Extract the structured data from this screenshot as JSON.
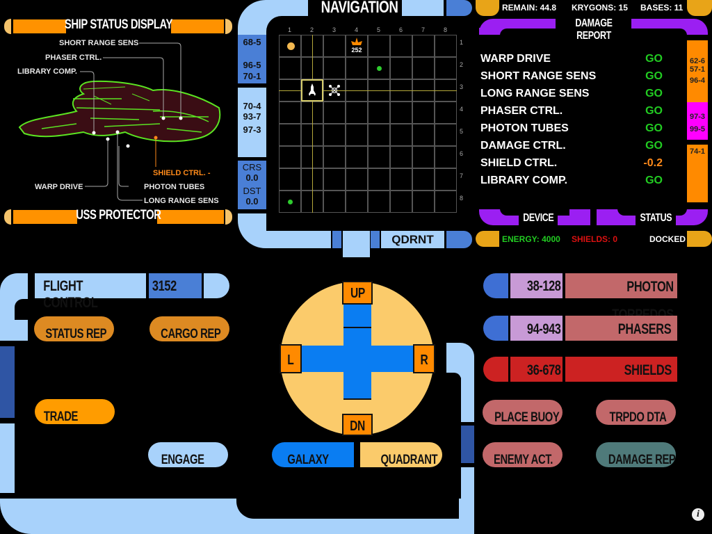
{
  "ship_status": {
    "title": "SHIP STATUS DISPLAY",
    "ship_name": "USS PROTECTOR",
    "labels": {
      "short_range": "SHORT RANGE SENS",
      "phaser": "PHASER CTRL.",
      "library": "LIBRARY COMP.",
      "shield": "SHIELD CTRL. -",
      "warp": "WARP DRIVE",
      "photon": "PHOTON TUBES",
      "long_range": "LONG RANGE SENS"
    }
  },
  "navigation": {
    "title": "NAVIGATION",
    "side_codes": [
      "68-5",
      "96-5",
      "70-1",
      "70-4",
      "93-7",
      "97-3"
    ],
    "crs_label": "CRS",
    "crs_value": "0.0",
    "dst_label": "DST",
    "dst_value": "0.0",
    "qdrnt_label": "QDRNT",
    "col_numbers": [
      "1",
      "2",
      "3",
      "4",
      "5",
      "6",
      "7",
      "8"
    ],
    "row_numbers": [
      "1",
      "2",
      "3",
      "4",
      "5",
      "6",
      "7",
      "8"
    ],
    "objects": [
      {
        "type": "star",
        "col": 1,
        "row": 1,
        "color": "#f2b850"
      },
      {
        "type": "enemy",
        "col": 4,
        "row": 1,
        "label": "252",
        "color": "#ff8a00"
      },
      {
        "type": "planet",
        "col": 5,
        "row": 2,
        "color": "#2ecc2e"
      },
      {
        "type": "player-ship",
        "col": 2,
        "row": 3
      },
      {
        "type": "starbase",
        "col": 3,
        "row": 3
      },
      {
        "type": "planet",
        "col": 1,
        "row": 8,
        "color": "#2ecc2e"
      }
    ]
  },
  "header_stats": {
    "remain": "REMAIN: 44.8",
    "krygons": "KRYGONS: 15",
    "bases": "BASES: 11"
  },
  "damage_report": {
    "title": "DAMAGE REPORT",
    "col_device": "DEVICE",
    "col_status": "STATUS",
    "rows": [
      {
        "device": "WARP DRIVE",
        "status": "GO",
        "color": "#22cc22"
      },
      {
        "device": "SHORT RANGE SENS",
        "status": "GO",
        "color": "#22cc22"
      },
      {
        "device": "LONG RANGE SENS",
        "status": "GO",
        "color": "#22cc22"
      },
      {
        "device": "PHASER CTRL.",
        "status": "GO",
        "color": "#22cc22"
      },
      {
        "device": "PHOTON TUBES",
        "status": "GO",
        "color": "#22cc22"
      },
      {
        "device": "DAMAGE CTRL.",
        "status": "GO",
        "color": "#22cc22"
      },
      {
        "device": "SHIELD CTRL.",
        "status": "-0.2",
        "color": "#ff8a1a"
      },
      {
        "device": "LIBRARY COMP.",
        "status": "GO",
        "color": "#22cc22"
      }
    ],
    "side_codes_orange_a": [
      "62-6",
      "57-1",
      "96-4"
    ],
    "side_codes_magenta": [
      "97-3",
      "99-5"
    ],
    "side_codes_orange_b": [
      "74-1"
    ]
  },
  "footer_stats": {
    "energy": "ENERGY: 4000",
    "shields": "SHIELDS: 0",
    "docked": "DOCKED",
    "energy_color": "#22cc22",
    "shields_color": "#dd1111"
  },
  "flight_control": {
    "title": "FLIGHT CONTROL",
    "code": "3152",
    "buttons": {
      "status_rep": "STATUS REP",
      "cargo_rep": "CARGO REP",
      "trade": "TRADE",
      "engage": "ENGAGE"
    }
  },
  "direction_pad": {
    "up": "UP",
    "down": "DN",
    "left": "L",
    "right": "R",
    "galaxy": "GALAXY",
    "quadrant": "QUADRANT"
  },
  "weapons": {
    "photon_code": "38-128",
    "photon_label": "PHOTON TORPEDOS",
    "phaser_code": "94-943",
    "phaser_label": "PHASERS",
    "shield_code": "36-678",
    "shield_label": "SHIELDS",
    "buttons": {
      "place_buoy": "PLACE BUOY",
      "trpdo_dta": "TRPDO DTA",
      "enemy_act": "ENEMY ACT.",
      "damage_rep": "DAMAGE REP."
    }
  },
  "info_glyph": "i"
}
